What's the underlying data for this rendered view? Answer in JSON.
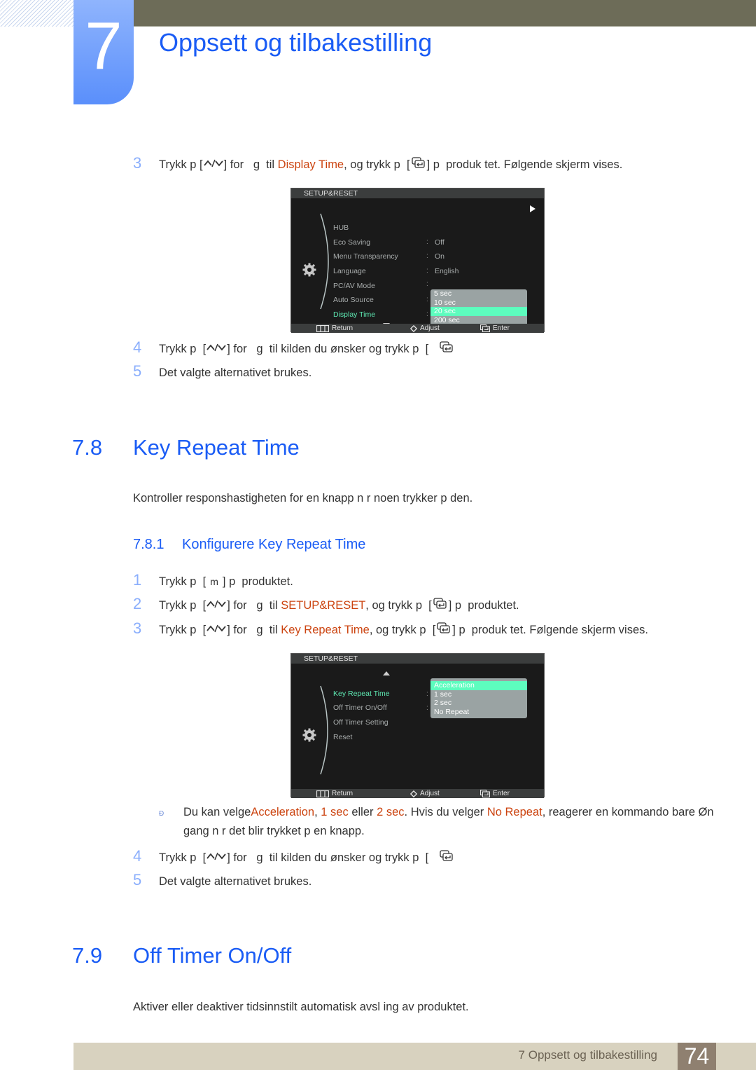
{
  "header": {
    "chapter_number": "7",
    "chapter_title": "Oppsett og tilbakestilling"
  },
  "section_display_time_tail": {
    "step3": {
      "num": "3",
      "pre": "Trykk p  [",
      "keys": "up-down-icon",
      "mid1": "] for   g  til ",
      "highlight": "Display Time",
      "mid2": ", og trykk p  [",
      "post": "] p  produk tet. Følgende skjerm vises."
    },
    "osd": {
      "title": "SETUP&RESET",
      "items": [
        {
          "label": "HUB",
          "value": ""
        },
        {
          "label": "Eco Saving",
          "value": "Off"
        },
        {
          "label": "Menu Transparency",
          "value": "On"
        },
        {
          "label": "Language",
          "value": "English"
        },
        {
          "label": "PC/AV Mode",
          "value": ""
        },
        {
          "label": "Auto Source",
          "value": ""
        },
        {
          "label": "Display Time",
          "value": "",
          "active": true
        }
      ],
      "dropdown": [
        "5 sec",
        "10 sec",
        "20 sec",
        "200 sec"
      ],
      "dropdown_selected": "20 sec",
      "footer": {
        "return": "Return",
        "adjust": "Adjust",
        "enter": "Enter"
      }
    },
    "step4": {
      "num": "4",
      "pre": "Trykk p  [",
      "mid": "] for   g  til kilden du ønsker og trykk p  ["
    },
    "step5": {
      "num": "5",
      "text": "Det valgte alternativet brukes."
    }
  },
  "section_key_repeat": {
    "number": "7.8",
    "title": "Key Repeat Time",
    "description": "Kontroller responshastigheten for en knapp n r noen trykker p  den.",
    "subsection": {
      "number": "7.8.1",
      "title": "Konfigurere Key Repeat Time"
    },
    "step1": {
      "num": "1",
      "pre": "Trykk p  [",
      "key": "m",
      "post": "] p  produktet."
    },
    "step2": {
      "num": "2",
      "pre": "Trykk p  [",
      "mid1": "] for   g  til ",
      "highlight": "SETUP&RESET",
      "mid2": ", og trykk p  [",
      "post": "] p  produktet."
    },
    "step3": {
      "num": "3",
      "pre": "Trykk p  [",
      "mid1": "] for   g  til ",
      "highlight": "Key Repeat Time",
      "mid2": ", og trykk p  [",
      "post": "] p  produk tet. Følgende skjerm vises."
    },
    "osd": {
      "title": "SETUP&RESET",
      "items": [
        {
          "label": "Key Repeat Time",
          "active": true
        },
        {
          "label": "Off Timer On/Off"
        },
        {
          "label": "Off Timer Setting"
        },
        {
          "label": "Reset"
        }
      ],
      "dropdown": [
        "Acceleration",
        "1 sec",
        "2 sec",
        "No Repeat"
      ],
      "dropdown_selected": "Acceleration",
      "footer": {
        "return": "Return",
        "adjust": "Adjust",
        "enter": "Enter"
      }
    },
    "note": {
      "icon": "Ð",
      "t1": "Du kan velge",
      "h1": "Acceleration",
      "t2": ", ",
      "h2": "1 sec",
      "t3": " eller ",
      "h3": "2 sec",
      "t4": ". Hvis du velger ",
      "h4": "No Repeat",
      "t5": ", reagerer en kommando bare Øn gang n r det blir trykket p  en knapp."
    },
    "step4": {
      "num": "4",
      "pre": "Trykk p  [",
      "mid": "] for   g  til kilden du ønsker og trykk p  ["
    },
    "step5": {
      "num": "5",
      "text": "Det valgte alternativet brukes."
    }
  },
  "section_off_timer": {
    "number": "7.9",
    "title": "Off Timer On/Off",
    "description": "Aktiver eller deaktiver tidsinnstilt automatisk avsl ing av produktet."
  },
  "footer": {
    "chapter_label": "7 Oppsett og tilbakestilling",
    "page_number": "74"
  },
  "colors": {
    "heading_blue": "#1a5cf5",
    "highlight_orange": "#cc4410",
    "osd_active_green": "#5ee8b2",
    "osd_selected_bg": "#5dfdbe"
  }
}
